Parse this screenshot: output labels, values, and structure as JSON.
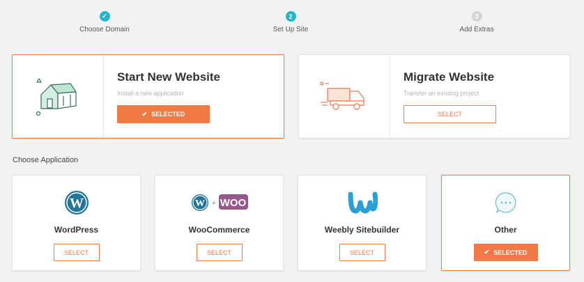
{
  "stepper": {
    "steps": [
      {
        "label": "Choose Domain",
        "marker": "✓",
        "state": "done"
      },
      {
        "label": "Set Up Site",
        "marker": "2",
        "state": "active"
      },
      {
        "label": "Add Extras",
        "marker": "3",
        "state": "pending"
      }
    ]
  },
  "start_card": {
    "title": "Start New Website",
    "subtitle": "Install a new application",
    "button": "SELECTED",
    "icon": "house-icon"
  },
  "migrate_card": {
    "title": "Migrate Website",
    "subtitle": "Transfer an existing project",
    "button": "SELECT",
    "icon": "moving-truck-icon"
  },
  "section_label": "Choose Application",
  "apps": [
    {
      "name": "WordPress",
      "button": "SELECT",
      "icon": "wordpress-icon"
    },
    {
      "name": "WooCommerce",
      "button": "SELECT",
      "icon": "woocommerce-icon",
      "logo_text": "WOO"
    },
    {
      "name": "Weebly Sitebuilder",
      "button": "SELECT",
      "icon": "weebly-icon"
    },
    {
      "name": "Other",
      "button": "SELECTED",
      "icon": "chat-bubble-icon"
    }
  ],
  "colors": {
    "accent": "#f07a45",
    "step": "#24b5c6",
    "woo": "#96588a",
    "wordpress": "#21759b",
    "weebly": "#2a9fd6"
  }
}
